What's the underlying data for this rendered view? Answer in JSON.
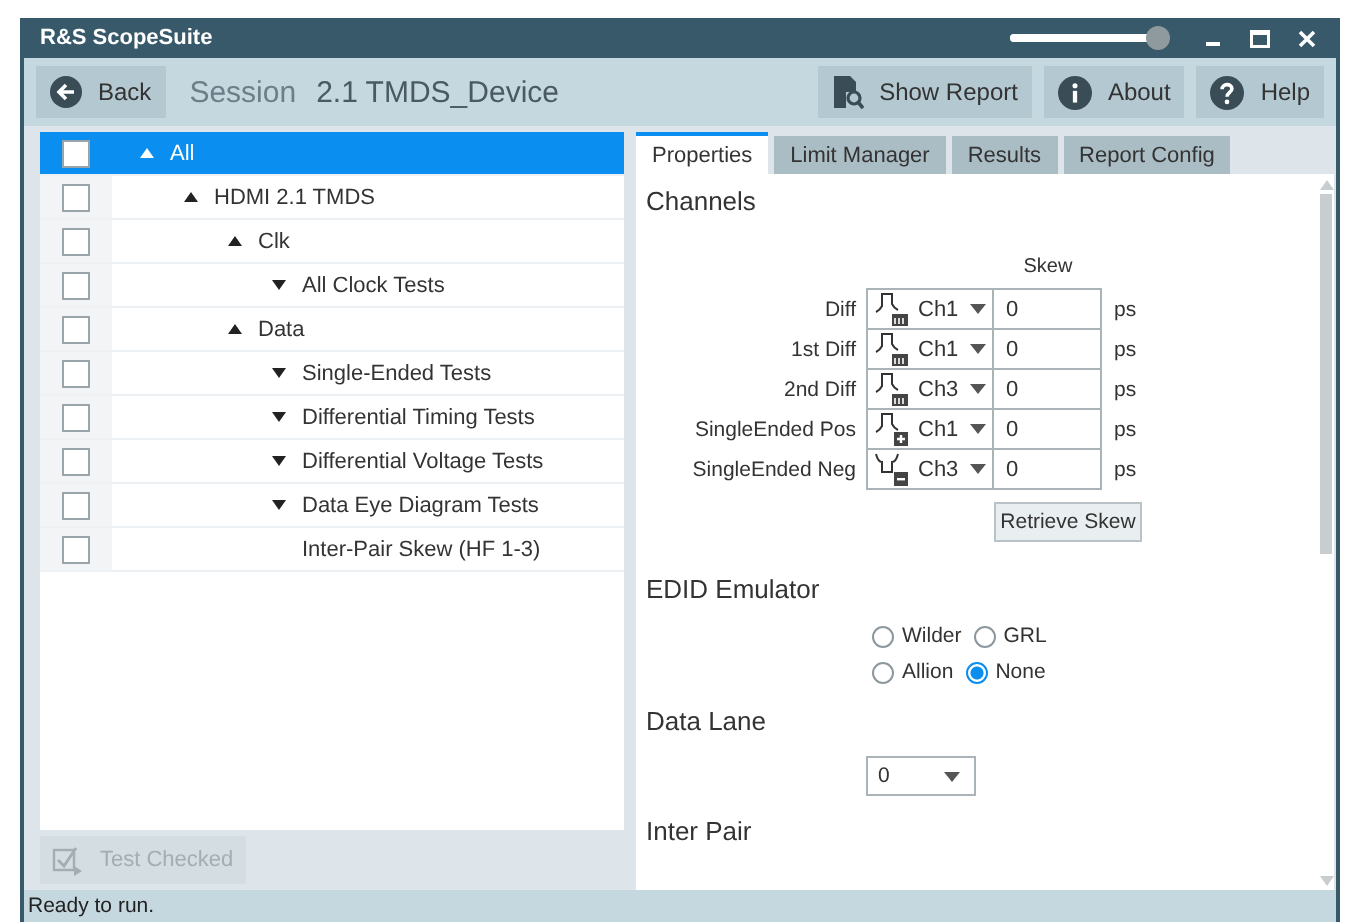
{
  "window": {
    "title": "R&S ScopeSuite",
    "zoom_slider": {
      "level": 0.97
    }
  },
  "toolbar": {
    "back": "Back",
    "session_label": "Session",
    "session_name": "2.1 TMDS_Device",
    "buttons": [
      {
        "kind": "report",
        "label": "Show Report"
      },
      {
        "kind": "about",
        "label": "About"
      },
      {
        "kind": "help",
        "label": "Help"
      }
    ]
  },
  "tree": [
    {
      "label": "All",
      "kind": "folder",
      "expanded": true,
      "checked": false,
      "selected": true,
      "children": [
        {
          "label": "HDMI 2.1 TMDS",
          "kind": "folder",
          "expanded": true,
          "checked": false,
          "selected": false,
          "children": [
            {
              "label": "Clk",
              "kind": "folder",
              "expanded": true,
              "checked": false,
              "selected": false,
              "children": [
                {
                  "label": "All Clock Tests",
                  "kind": "folder",
                  "expanded": false,
                  "checked": false,
                  "selected": false
                }
              ]
            },
            {
              "label": "Data",
              "kind": "folder",
              "expanded": true,
              "checked": false,
              "selected": false,
              "children": [
                {
                  "label": "Single-Ended Tests",
                  "kind": "folder",
                  "expanded": false,
                  "checked": false,
                  "selected": false
                },
                {
                  "label": "Differential Timing Tests",
                  "kind": "folder",
                  "expanded": false,
                  "checked": false,
                  "selected": false
                },
                {
                  "label": "Differential Voltage Tests",
                  "kind": "folder",
                  "expanded": false,
                  "checked": false,
                  "selected": false
                },
                {
                  "label": "Data Eye Diagram Tests",
                  "kind": "folder",
                  "expanded": false,
                  "checked": false,
                  "selected": false
                },
                {
                  "label": "Inter-Pair Skew (HF 1-3)",
                  "kind": "leaf",
                  "checked": false,
                  "selected": false
                }
              ]
            }
          ]
        }
      ]
    }
  ],
  "test_checked": {
    "label": "Test Checked",
    "disabled": true
  },
  "tabs": [
    {
      "label": "Properties",
      "selected": true
    },
    {
      "label": "Limit Manager",
      "selected": false
    },
    {
      "label": "Results",
      "selected": false
    },
    {
      "label": "Report Config",
      "selected": false
    }
  ],
  "channels": {
    "title": "Channels",
    "skew_header": "Skew",
    "rows": [
      {
        "label": "Diff",
        "kind": "diff",
        "channel": "Ch1",
        "skew": "0",
        "unit": "ps"
      },
      {
        "label": "1st Diff",
        "kind": "diff",
        "channel": "Ch1",
        "skew": "0",
        "unit": "ps"
      },
      {
        "label": "2nd Diff",
        "kind": "diff",
        "channel": "Ch3",
        "skew": "0",
        "unit": "ps"
      },
      {
        "label": "SingleEnded Pos",
        "kind": "pos",
        "channel": "Ch1",
        "skew": "0",
        "unit": "ps"
      },
      {
        "label": "SingleEnded Neg",
        "kind": "neg",
        "channel": "Ch3",
        "skew": "0",
        "unit": "ps"
      }
    ],
    "retrieve_button": "Retrieve Skew"
  },
  "edid": {
    "title": "EDID Emulator",
    "options": [
      [
        {
          "label": "Wilder",
          "selected": false
        },
        {
          "label": "GRL",
          "selected": false
        }
      ],
      [
        {
          "label": "Allion",
          "selected": false
        },
        {
          "label": "None",
          "selected": true
        }
      ]
    ]
  },
  "data_lane": {
    "title": "Data Lane",
    "value": "0"
  },
  "inter_pair": {
    "title": "Inter Pair"
  },
  "status_bar": "Ready to run."
}
